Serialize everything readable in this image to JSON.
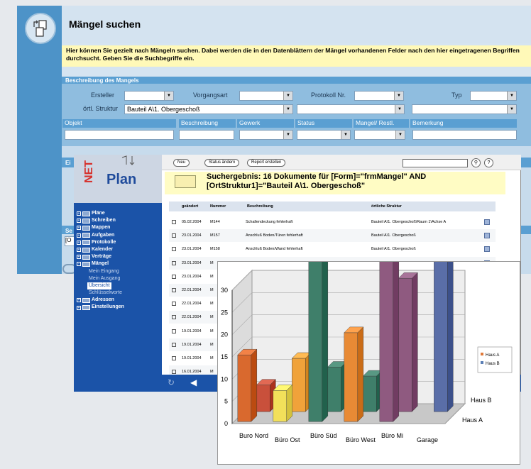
{
  "search_window": {
    "title": "Mängel suchen",
    "info": "Hier können Sie gezielt nach Mängeln suchen. Dabei werden die in den Datenblättern der Mängel vorhandenen Felder nach den hier eingetragenen Begriffen durchsucht. Geben Sie die Suchbegriffe ein.",
    "section_title": "Beschreibung des Mangels",
    "labels": {
      "ersteller": "Ersteller",
      "vorgangsart": "Vorgangsart",
      "protokoll_nr": "Protokoll Nr.",
      "typ": "Typ",
      "ortl_struktur": "örtl. Struktur"
    },
    "ortl_struktur_value": "Bauteil A\\1. Obergeschoß",
    "columns": [
      "Objekt",
      "Beschreibung",
      "Gewerk",
      "Status",
      "Mangel/ Restl.",
      "Bemerkung"
    ],
    "partial_labels": [
      "Ei",
      "Se",
      "[O"
    ]
  },
  "netplan": {
    "logo_net": "NET",
    "logo_plan": "Plan",
    "toolbar": {
      "new": "Neu",
      "status": "Status ändern",
      "report": "Report erstellen"
    },
    "result_text": "Suchergebnis: 16 Dokumente für [Form]=\"frmMangel\" AND [OrtStruktur1]=\"Bauteil A\\1. Obergeschoß\"",
    "grid_headers": [
      "geändert",
      "Nummer",
      "Beschreibung",
      "örtliche Struktur"
    ],
    "rows": [
      {
        "date": "05.02.2004",
        "num": "M144",
        "desc": "Schallendeckung fehlerhaft",
        "struct": "Bauteil A\\1. Obergeschoß\\Raum 1\\Achse A"
      },
      {
        "date": "23.01.2004",
        "num": "M157",
        "desc": "Anschluß Boden/Türen fehlerhaft",
        "struct": "Bauteil A\\1. Obergeschoß"
      },
      {
        "date": "23.01.2004",
        "num": "M158",
        "desc": "Anschluß Boden/Wand fehlerhaft",
        "struct": "Bauteil A\\1. Obergeschoß"
      },
      {
        "date": "23.01.2004",
        "num": "M",
        "desc": "",
        "struct": ""
      },
      {
        "date": "23.01.2004",
        "num": "M",
        "desc": "",
        "struct": ""
      },
      {
        "date": "22.01.2004",
        "num": "M",
        "desc": "",
        "struct": ""
      },
      {
        "date": "22.01.2004",
        "num": "M",
        "desc": "",
        "struct": ""
      },
      {
        "date": "22.01.2004",
        "num": "M",
        "desc": "",
        "struct": ""
      },
      {
        "date": "19.01.2004",
        "num": "M",
        "desc": "",
        "struct": ""
      },
      {
        "date": "19.01.2004",
        "num": "M",
        "desc": "",
        "struct": ""
      },
      {
        "date": "19.01.2004",
        "num": "M",
        "desc": "",
        "struct": ""
      },
      {
        "date": "16.01.2004",
        "num": "M",
        "desc": "",
        "struct": ""
      }
    ],
    "nav": [
      {
        "label": "Pläne",
        "exp": "+"
      },
      {
        "label": "Schreiben",
        "exp": "+"
      },
      {
        "label": "Mappen",
        "exp": "+"
      },
      {
        "label": "Aufgaben",
        "exp": "+"
      },
      {
        "label": "Protokolle",
        "exp": "+"
      },
      {
        "label": "Kalender",
        "exp": "+"
      },
      {
        "label": "Verträge",
        "exp": "+"
      },
      {
        "label": "Mängel",
        "exp": "-"
      }
    ],
    "nav_sub": [
      "Mein Eingang",
      "Mein Ausgang",
      "Übersicht",
      "Schlüsselworte"
    ],
    "nav_after": [
      {
        "label": "Adressen",
        "exp": "+"
      },
      {
        "label": "Einstellungen",
        "exp": "+"
      }
    ]
  },
  "chart_data": {
    "type": "bar",
    "subtype": "3d-clustered",
    "categories": [
      "Buro Nord",
      "Büro Ost",
      "Büro Süd",
      "Büro West",
      "Büro Mi",
      "Garage"
    ],
    "series": [
      {
        "name": "Haus A",
        "color": "#e07a3a",
        "values": [
          15,
          7,
          40,
          20,
          36,
          0
        ]
      },
      {
        "name": "Haus B",
        "color": "#5b7fb5",
        "values": [
          6,
          12,
          10,
          8,
          30,
          34
        ]
      }
    ],
    "bar_colors": [
      "#d9692e",
      "#f2e05a",
      "#3f7f6a",
      "#e88a35",
      "#8f5a80",
      "#5a6ea8"
    ],
    "back_colors": [
      "#c9503b",
      "#f0a23a",
      "#3f7f6a",
      "#3f7f6a",
      "#8f5a80",
      "#5a6ea8"
    ],
    "yticks": [
      "0",
      "5",
      "10",
      "15",
      "20",
      "25",
      "30"
    ],
    "ylim": [
      0,
      30
    ],
    "depth_labels": [
      "Haus A",
      "Haus B"
    ],
    "legend": [
      "Haus A",
      "Haus B"
    ],
    "legend_position": "right",
    "grid": true
  }
}
